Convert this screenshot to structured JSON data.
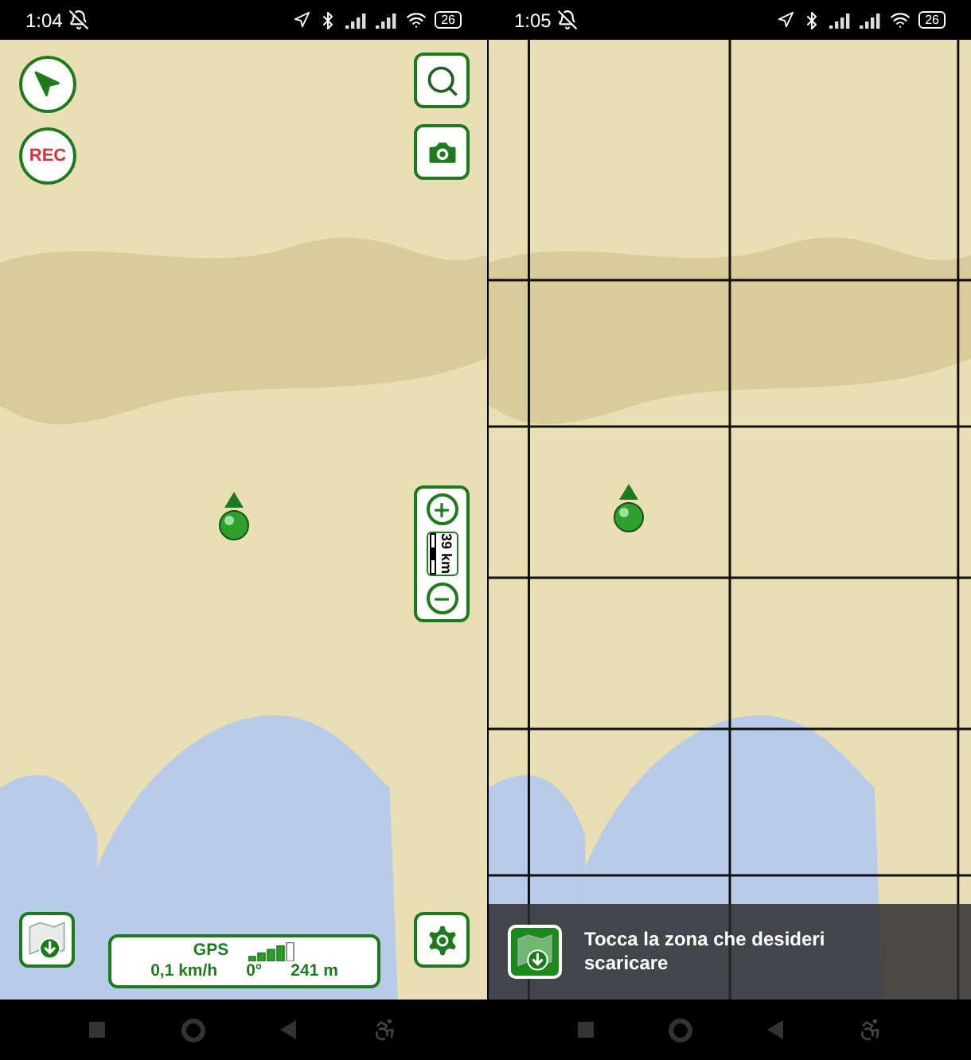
{
  "screens": [
    {
      "kind": "map",
      "status_bar": {
        "time": "1:04",
        "battery": "26"
      },
      "record_button": {
        "label": "REC"
      },
      "zoom_control": {
        "scale": "39 km"
      },
      "gps_panel": {
        "label": "GPS",
        "speed": "0,1 km/h",
        "heading": "0°",
        "altitude": "241 m"
      }
    },
    {
      "kind": "download",
      "status_bar": {
        "time": "1:05",
        "battery": "26"
      },
      "toast": {
        "message": "Tocca la zona che desideri scaricare"
      }
    }
  ]
}
